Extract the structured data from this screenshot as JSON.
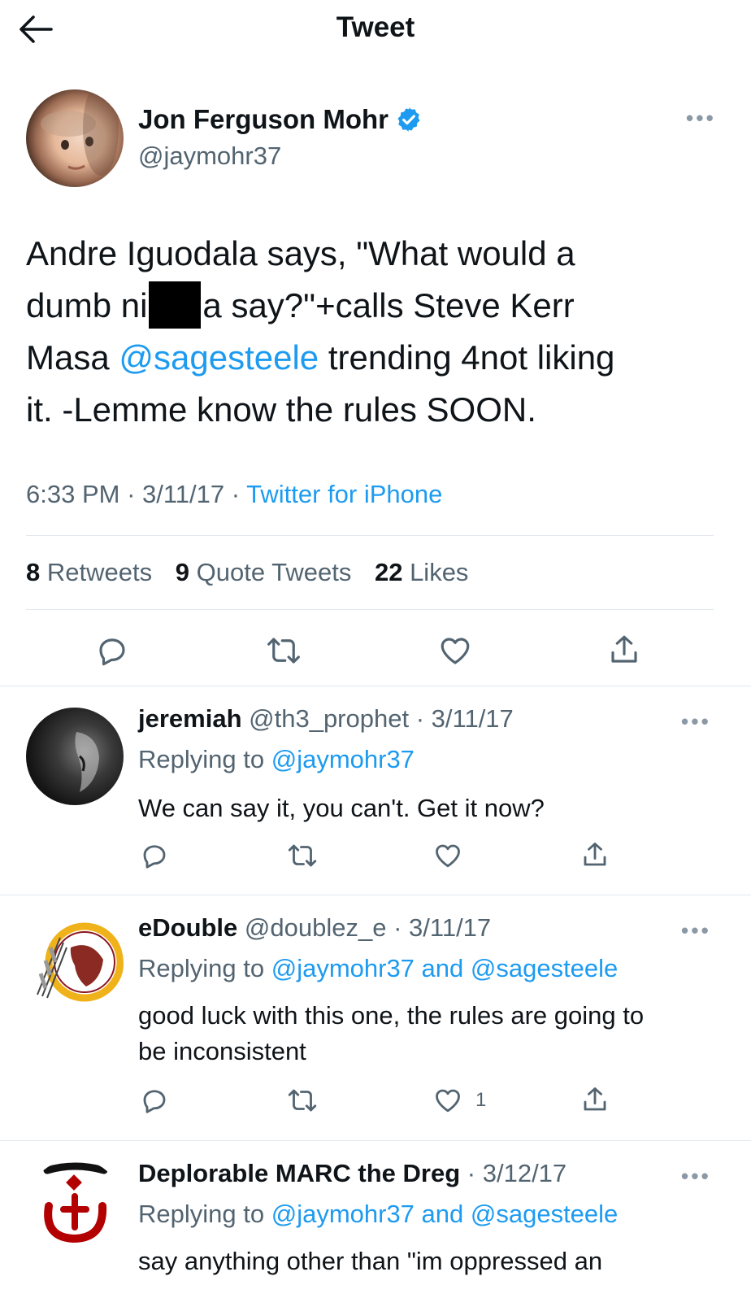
{
  "header": {
    "title": "Tweet"
  },
  "tweet": {
    "display_name": "Jon Ferguson Mohr",
    "handle": "@jaymohr37",
    "text_line1": "Andre Iguodala says, \"What would a",
    "text_line2_a": "dumb ni",
    "text_line2_b": "a say?\"+calls Steve Kerr",
    "text_line3_a": "Masa ",
    "text_line3_mention": "@sagesteele",
    "text_line3_b": " trending 4not liking",
    "text_line4": "it. -Lemme know the rules SOON.",
    "time": "6:33 PM",
    "date": "3/11/17",
    "source": "Twitter for iPhone",
    "retweets": "8",
    "retweets_label": "Retweets",
    "quotes": "9",
    "quotes_label": "Quote Tweets",
    "likes": "22",
    "likes_label": "Likes"
  },
  "replies": [
    {
      "name": "jeremiah",
      "handle": "@th3_prophet",
      "date": "3/11/17",
      "replying_label": "Replying to",
      "replying_to": "@jaymohr37",
      "text": "We can say it, you can't. Get it now?"
    },
    {
      "name": "eDouble",
      "handle": "@doublez_e",
      "date": "3/11/17",
      "replying_label": "Replying to",
      "replying_to": "@jaymohr37 and @sagesteele",
      "text_line1": "good luck with this one, the rules are going to",
      "text_line2": "be inconsistent",
      "like_count": "1"
    },
    {
      "name": "Deplorable MARC the Dreg",
      "date": "3/12/17",
      "replying_label": "Replying to",
      "replying_to": "@jaymohr37 and @sagesteele",
      "text": "say anything other than \"im oppressed an"
    }
  ],
  "colors": {
    "link": "#1d9bf0",
    "secondary": "#536471",
    "divider": "#e1e8ed"
  },
  "icons": [
    "back-arrow-icon",
    "verified-badge-icon",
    "more-icon",
    "reply-icon",
    "retweet-icon",
    "like-icon",
    "share-icon"
  ]
}
